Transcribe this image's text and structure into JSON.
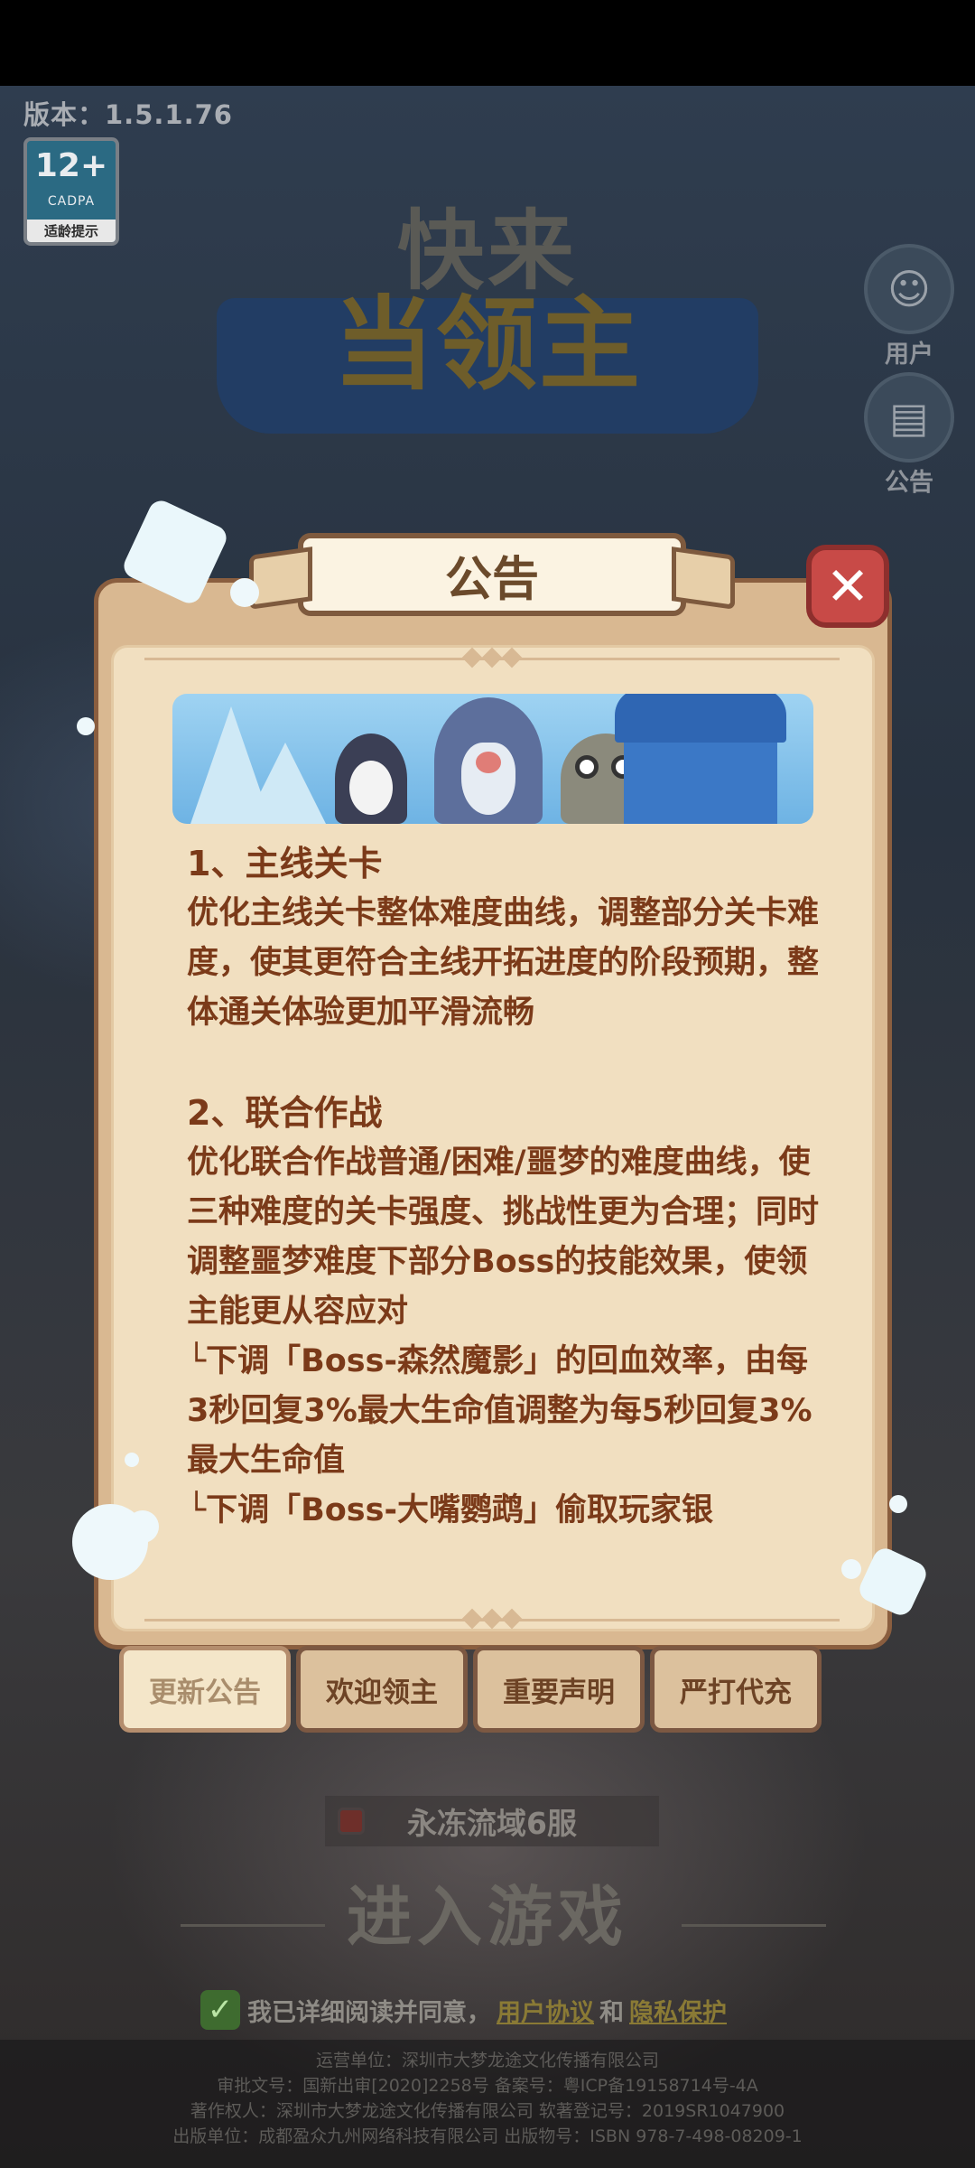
{
  "version": "版本：1.5.1.76",
  "age_badge": {
    "rating": "12+",
    "org": "CADPA",
    "label": "适龄提示"
  },
  "logo": {
    "line1": "快来",
    "line2": "当领主"
  },
  "side_buttons": {
    "user": "用户",
    "notice": "公告"
  },
  "dialog": {
    "title": "公告",
    "sections": [
      {
        "title": "1、主线关卡",
        "body": "优化主线关卡整体难度曲线，调整部分关卡难度，使其更符合主线开拓进度的阶段预期，整体通关体验更加平滑流畅"
      },
      {
        "title": "2、联合作战",
        "body": "优化联合作战普通/困难/噩梦的难度曲线，使三种难度的关卡强度、挑战性更为合理；同时调整噩梦难度下部分Boss的技能效果，使领主能更从容应对"
      }
    ],
    "sub_items": [
      "└下调「Boss-森然魔影」的回血效率，由每3秒回复3%最大生命值调整为每5秒回复3%最大生命值",
      "└下调「Boss-大嘴鹦鹉」偷取玩家银"
    ]
  },
  "tabs": [
    {
      "label": "更新公告",
      "active": true
    },
    {
      "label": "欢迎领主",
      "active": false
    },
    {
      "label": "重要声明",
      "active": false
    },
    {
      "label": "严打代充",
      "active": false
    }
  ],
  "server": "永冻流域6服",
  "enter_game": "进入游戏",
  "agreement": {
    "prefix": "我已详细阅读并同意，",
    "user_agreement": "用户协议",
    "and": "和",
    "privacy": "隐私保护"
  },
  "footer": [
    "运营单位：深圳市大梦龙途文化传播有限公司",
    "审批文号：国新出审[2020]2258号  备案号：粤ICP备19158714号-4A",
    "著作权人：深圳市大梦龙途文化传播有限公司  软著登记号：2019SR1047900",
    "出版单位：成都盈众九州网络科技有限公司  出版物号：ISBN 978-7-498-08209-1"
  ]
}
